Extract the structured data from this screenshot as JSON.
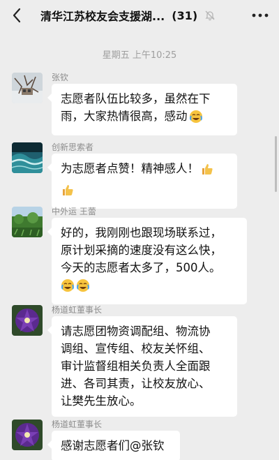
{
  "header": {
    "back_icon": "chevron-left-icon",
    "title": "清华江苏校友会支援湖...",
    "member_count": "(31)",
    "mute_icon": "bell-muted-icon",
    "more_icon": "more-dots-icon"
  },
  "timestamp": "星期五 上午10:25",
  "messages": [
    {
      "sender": "张钦",
      "avatar": "snow-scene-avatar",
      "lines": [
        "志愿者队伍比较多，虽然在下",
        "雨，大家热情很高，感动"
      ],
      "emoji": [
        "crying-laughing-emoji"
      ]
    },
    {
      "sender": "创新思索者",
      "avatar": "ocean-wave-avatar",
      "lines": [
        "为志愿者点赞！精神感人！",
        ""
      ],
      "emoji": [
        "thumbs-up-emoji",
        "thumbs-up-emoji"
      ]
    },
    {
      "sender": "中外运 王蕾",
      "avatar": "green-field-avatar",
      "lines": [
        "好的，我刚刚也跟现场联系过，",
        "原计划采摘的速度没有这么快，",
        "今天的志愿者太多了，500人。",
        ""
      ],
      "emoji": [
        "crying-laughing-emoji",
        "crying-laughing-emoji"
      ]
    },
    {
      "sender": "杨道虹董事长",
      "avatar": "purple-flower-avatar",
      "lines": [
        "请志愿团物资调配组、物流协",
        "调组、宣传组、校友关怀组、",
        "审计监督组相关负责人全面跟",
        "进、各司其责，让校友放心、",
        "让樊先生放心。"
      ]
    },
    {
      "sender": "杨道虹董事长",
      "avatar": "purple-flower-avatar",
      "lines": [
        "感谢志愿者们@张钦"
      ]
    }
  ]
}
